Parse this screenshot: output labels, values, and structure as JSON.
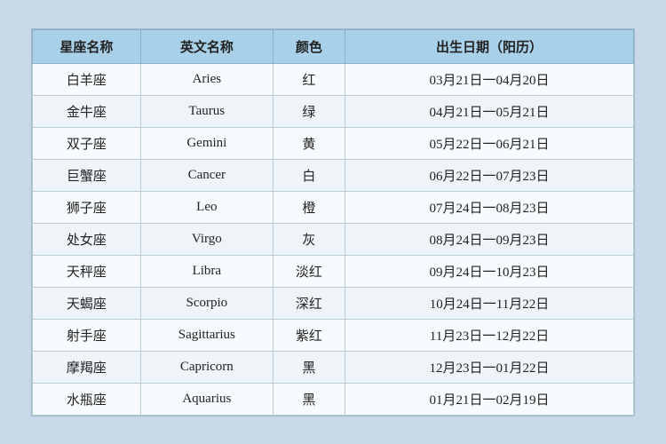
{
  "table": {
    "headers": [
      "星座名称",
      "英文名称",
      "颜色",
      "出生日期（阳历）"
    ],
    "rows": [
      {
        "chinese": "白羊座",
        "english": "Aries",
        "color": "红",
        "date": "03月21日一04月20日"
      },
      {
        "chinese": "金牛座",
        "english": "Taurus",
        "color": "绿",
        "date": "04月21日一05月21日"
      },
      {
        "chinese": "双子座",
        "english": "Gemini",
        "color": "黄",
        "date": "05月22日一06月21日"
      },
      {
        "chinese": "巨蟹座",
        "english": "Cancer",
        "color": "白",
        "date": "06月22日一07月23日"
      },
      {
        "chinese": "狮子座",
        "english": "Leo",
        "color": "橙",
        "date": "07月24日一08月23日"
      },
      {
        "chinese": "处女座",
        "english": "Virgo",
        "color": "灰",
        "date": "08月24日一09月23日"
      },
      {
        "chinese": "天秤座",
        "english": "Libra",
        "color": "淡红",
        "date": "09月24日一10月23日"
      },
      {
        "chinese": "天蝎座",
        "english": "Scorpio",
        "color": "深红",
        "date": "10月24日一11月22日"
      },
      {
        "chinese": "射手座",
        "english": "Sagittarius",
        "color": "紫红",
        "date": "11月23日一12月22日"
      },
      {
        "chinese": "摩羯座",
        "english": "Capricorn",
        "color": "黑",
        "date": "12月23日一01月22日"
      },
      {
        "chinese": "水瓶座",
        "english": "Aquarius",
        "color": "黑",
        "date": "01月21日一02月19日"
      }
    ]
  }
}
